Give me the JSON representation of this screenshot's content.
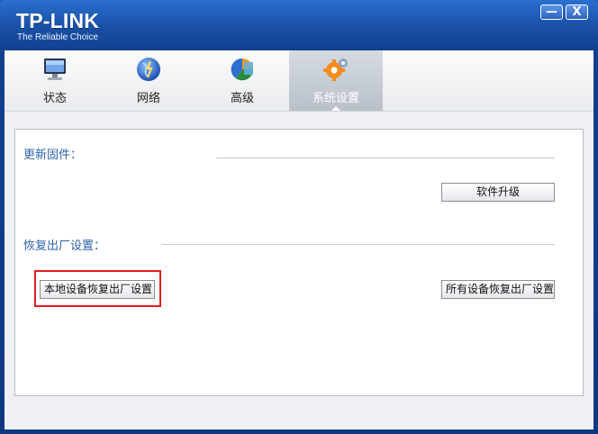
{
  "window": {
    "brand_name": "TP-LINK",
    "brand_tagline": "The Reliable Choice",
    "minimize_label": "—",
    "close_label": "X"
  },
  "tabs": [
    {
      "label": "状态",
      "icon": "monitor-icon",
      "active": false
    },
    {
      "label": "网络",
      "icon": "globe-icon",
      "active": false
    },
    {
      "label": "高级",
      "icon": "pie-chart-icon",
      "active": false
    },
    {
      "label": "系统设置",
      "icon": "gears-icon",
      "active": true
    }
  ],
  "firmware": {
    "title": "更新固件：",
    "upgrade_button": "软件升级"
  },
  "factory_reset": {
    "title": "恢复出厂设置：",
    "local_reset_button": "本地设备恢复出厂设置",
    "all_reset_button": "所有设备恢复出厂设置"
  },
  "colors": {
    "title_bar": "#1a52a8",
    "section_title": "#2e63a8",
    "highlight": "#e31d24"
  }
}
